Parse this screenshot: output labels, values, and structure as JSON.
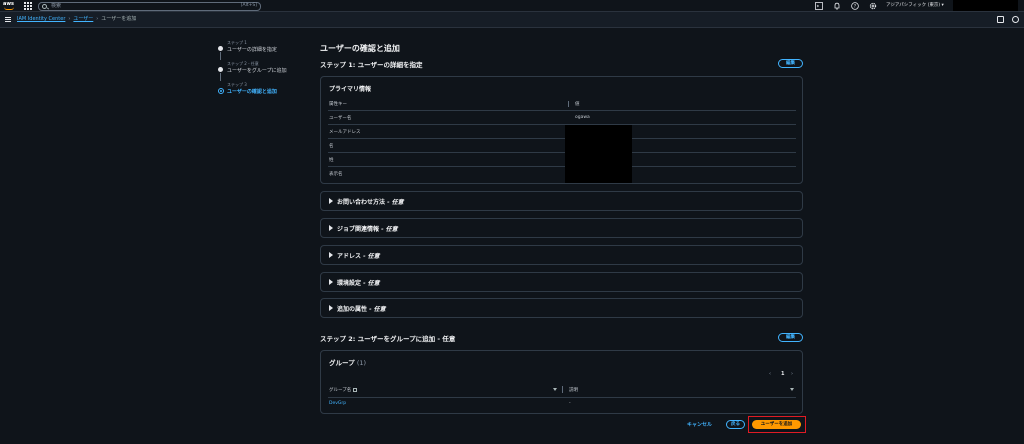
{
  "topnav": {
    "logo": "aws",
    "search_placeholder": "検索",
    "search_shortcut": "[Alt+S]",
    "region": "アジアパシフィック (東京) ▾",
    "icons": [
      "cloudshell-icon",
      "bell-icon",
      "help-icon",
      "gear-icon"
    ]
  },
  "breadcrumb": {
    "items": [
      "IAM Identity Center",
      "ユーザー"
    ],
    "current": "ユーザーを追加"
  },
  "steps": [
    {
      "num": "ステップ 1",
      "label": "ユーザーの詳細を指定"
    },
    {
      "num": "ステップ 2 - 任意",
      "label": "ユーザーをグループに追加"
    },
    {
      "num": "ステップ 3",
      "label": "ユーザーの確認と追加"
    }
  ],
  "page_title": "ユーザーの確認と追加",
  "step1": {
    "title": "ステップ 1: ユーザーの詳細を指定",
    "edit_label": "編集",
    "primary": {
      "title": "プライマリ情報",
      "header_key": "属性キー",
      "header_value": "値",
      "rows": [
        {
          "key": "ユーザー名",
          "value": "ogawa"
        },
        {
          "key": "メールアドレス",
          "value": ""
        },
        {
          "key": "名",
          "value": ""
        },
        {
          "key": "姓",
          "value": ""
        },
        {
          "key": "表示名",
          "value": ""
        }
      ]
    },
    "expanders": [
      {
        "label": "お問い合わせ方法",
        "opt": " - 任意"
      },
      {
        "label": "ジョブ関連情報",
        "opt": " - 任意"
      },
      {
        "label": "アドレス",
        "opt": " - 任意"
      },
      {
        "label": "環境設定",
        "opt": " - 任意"
      },
      {
        "label": "追加の属性",
        "opt": " - 任意"
      }
    ]
  },
  "step2": {
    "title": "ステップ 2: ユーザーをグループに追加 - 任意",
    "edit_label": "編集",
    "group": {
      "title": "グループ",
      "count": "(1)",
      "page": "1",
      "col_name": "グループ名",
      "col_desc": "説明",
      "rows": [
        {
          "name": "DevGrp",
          "desc": "-"
        }
      ]
    }
  },
  "footer": {
    "cancel": "キャンセル",
    "back": "戻る",
    "add": "ユーザーを追加"
  }
}
